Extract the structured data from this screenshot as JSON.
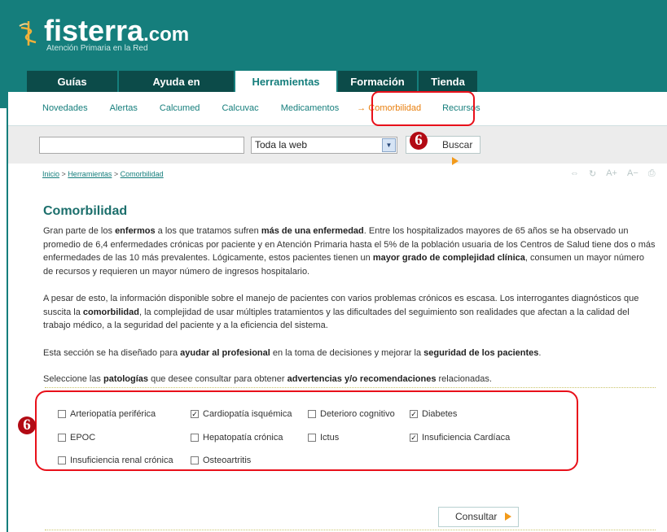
{
  "brand": {
    "name": "fisterra",
    "tld": ".com",
    "tagline": "Atención Primaria en la Red"
  },
  "tabs": [
    {
      "label": "Guías clínicas",
      "active": false
    },
    {
      "label": "Ayuda en consulta",
      "active": false
    },
    {
      "label": "Herramientas",
      "active": true
    },
    {
      "label": "Formación",
      "active": false
    },
    {
      "label": "Tienda",
      "active": false
    }
  ],
  "submenu": [
    {
      "label": "Novedades"
    },
    {
      "label": "Alertas"
    },
    {
      "label": "Calcumed"
    },
    {
      "label": "Calcuvac"
    },
    {
      "label": "Medicamentos"
    },
    {
      "label": "→ Comorbilidad",
      "current": true
    },
    {
      "label": "Recursos"
    }
  ],
  "search": {
    "value": "",
    "scope": "Toda la web",
    "button_label": "Buscar"
  },
  "breadcrumb": {
    "items": [
      "Inicio",
      "Herramientas",
      "Comorbilidad"
    ],
    "separator": ">"
  },
  "tools": [
    "⇔",
    "↻",
    "A+",
    "A−",
    "⎙"
  ],
  "page": {
    "title": "Comorbilidad",
    "p1": {
      "t1": "Gran parte de los ",
      "b1": "enfermos",
      "t2": " a los que tratamos sufren ",
      "b2": "más de una enfermedad",
      "t3": ". Entre los hospitalizados mayores de 65 años se ha observado un promedio de 6,4 enfermedades crónicas por paciente y en Atención Primaria hasta el 5% de la población usuaria de los Centros de Salud tiene dos o más enfermedades de las 10 más prevalentes. Lógicamente, estos pacientes tienen un ",
      "b3": "mayor grado de complejidad clínica",
      "t4": ", consumen un mayor número de recursos y requieren un mayor número de ingresos hospitalario."
    },
    "p2": {
      "t1": "A pesar de esto, la información disponible sobre el manejo de pacientes con varios problemas crónicos es escasa. Los interrogantes diagnósticos que suscita la ",
      "b1": "comorbilidad",
      "t2": ", la complejidad de usar múltiples tratamientos y las dificultades del seguimiento son realidades que afectan a la calidad del trabajo médico, a la seguridad del paciente y a la eficiencia del sistema."
    },
    "p3": {
      "t1": "Esta sección se ha diseñado para ",
      "b1": "ayudar al profesional",
      "t2": " en la toma de decisiones y mejorar la ",
      "b2": "seguridad de los pacientes",
      "t3": "."
    },
    "p4": {
      "t1": "Seleccione las ",
      "b1": "patologías",
      "t2": " que desee consultar para obtener ",
      "b2": "advertencias y/o recomendaciones",
      "t3": " relacionadas."
    }
  },
  "conditions": [
    {
      "label": "Arteriopatía periférica",
      "checked": false
    },
    {
      "label": "Cardiopatía isquémica",
      "checked": true
    },
    {
      "label": "Deterioro cognitivo",
      "checked": false
    },
    {
      "label": "Diabetes",
      "checked": true
    },
    {
      "label": "EPOC",
      "checked": false
    },
    {
      "label": "Hepatopatía crónica",
      "checked": false
    },
    {
      "label": "Ictus",
      "checked": false
    },
    {
      "label": "Insuficiencia Cardíaca",
      "checked": true
    },
    {
      "label": "Insuficiencia renal crónica",
      "checked": false
    },
    {
      "label": "Osteoartritis",
      "checked": false
    }
  ],
  "submit_label": "Consultar",
  "annotations": {
    "badge_top": "6",
    "badge_left": "6",
    "highlight_color": "#e8101a"
  },
  "colors": {
    "brand_teal": "#157e7c",
    "tab_dark": "#0c4b49",
    "accent_orange": "#e87f0e"
  }
}
